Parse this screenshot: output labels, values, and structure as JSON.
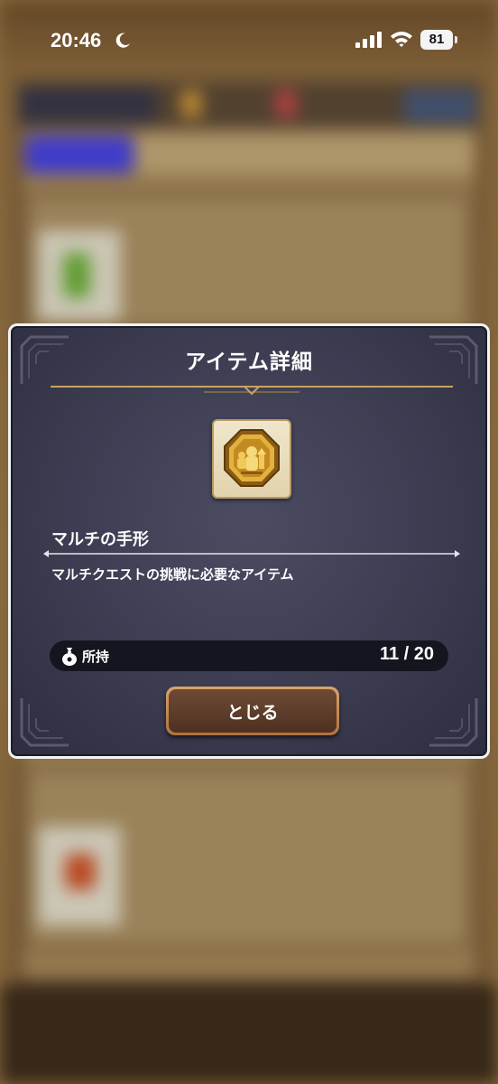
{
  "status_bar": {
    "time": "20:46",
    "battery": "81",
    "icons": [
      "moon-icon",
      "cellular-signal-icon",
      "wifi-icon",
      "battery-icon"
    ]
  },
  "dialog": {
    "title": "アイテム詳細",
    "item": {
      "icon": "multi-token-medal-icon",
      "name": "マルチの手形",
      "description": "マルチクエストの挑戦に必要なアイテム"
    },
    "ownership": {
      "icon": "bag-icon",
      "label": "所持",
      "count": "11 / 20"
    },
    "close_button": "とじる"
  },
  "colors": {
    "dialog_bg": "#3b3b50",
    "accent_gold": "#c9a35c",
    "button_border": "#d9a46a",
    "button_fill": "#5e3d2b"
  }
}
